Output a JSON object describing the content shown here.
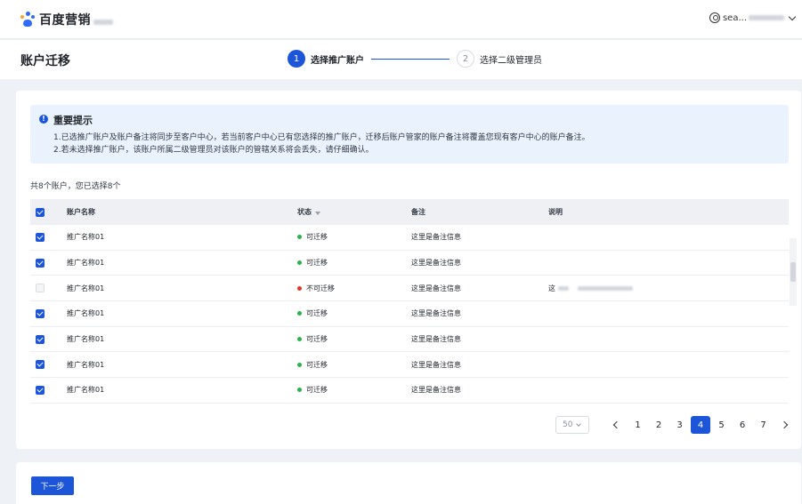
{
  "brand": {
    "name": "百度营销"
  },
  "user": {
    "name": "sea..."
  },
  "page": {
    "title": "账户迁移"
  },
  "steps": [
    {
      "num": "1",
      "label": "选择推广账户",
      "active": true
    },
    {
      "num": "2",
      "label": "选择二级管理员",
      "active": false
    }
  ],
  "alert": {
    "icon": "info-icon",
    "title": "重要提示",
    "lines": [
      "1.已选推广账户及账户备注将同步至客户中心，若当前客户中心已有您选择的推广账户，迁移后账户管家的账户备注将覆盖您现有客户中心的账户备注。",
      "2.若未选择推广账户，该账户所属二级管理员对该账户的管辖关系将会丢失，请仔细确认。"
    ]
  },
  "summary": "共8个账户，您已选择8个",
  "table": {
    "columns": {
      "name": "账户名称",
      "status": "状态",
      "remark": "备注",
      "desc": "说明"
    },
    "rows": [
      {
        "name": "推广名称01",
        "status": "可迁移",
        "ok": true,
        "remark": "这里是备注信息",
        "desc": "",
        "checked": true
      },
      {
        "name": "推广名称01",
        "status": "可迁移",
        "ok": true,
        "remark": "这里是备注信息",
        "desc": "",
        "checked": true
      },
      {
        "name": "推广名称01",
        "status": "不可迁移",
        "ok": false,
        "remark": "这里是备注信息",
        "desc": "这",
        "checked": false
      },
      {
        "name": "推广名称01",
        "status": "可迁移",
        "ok": true,
        "remark": "这里是备注信息",
        "desc": "",
        "checked": true
      },
      {
        "name": "推广名称01",
        "status": "可迁移",
        "ok": true,
        "remark": "这里是备注信息",
        "desc": "",
        "checked": true
      },
      {
        "name": "推广名称01",
        "status": "可迁移",
        "ok": true,
        "remark": "这里是备注信息",
        "desc": "",
        "checked": true
      },
      {
        "name": "推广名称01",
        "status": "可迁移",
        "ok": true,
        "remark": "这里是备注信息",
        "desc": "",
        "checked": true
      }
    ]
  },
  "pagination": {
    "page_size": "50",
    "pages": [
      "1",
      "2",
      "3",
      "4",
      "5",
      "6",
      "7"
    ],
    "current": "4"
  },
  "footer": {
    "next_label": "下一步"
  },
  "colors": {
    "primary": "#1d55d8",
    "ok": "#2bb24c",
    "error": "#e5352b",
    "alert_bg": "#eaf2fd"
  }
}
